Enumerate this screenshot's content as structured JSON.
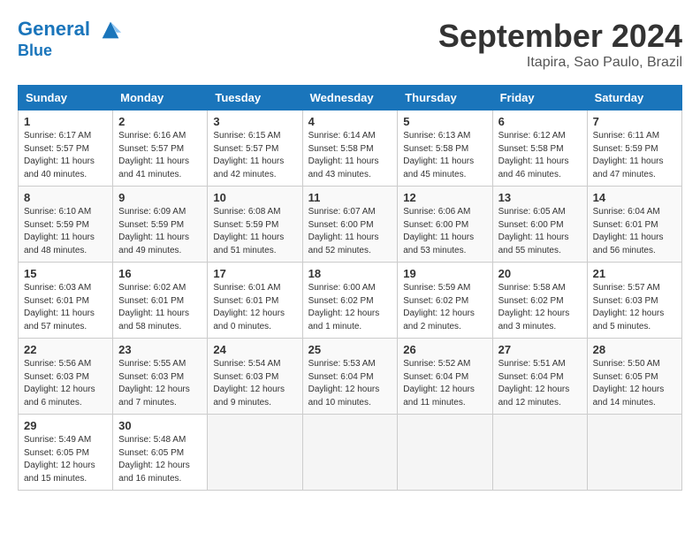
{
  "header": {
    "logo_line1": "General",
    "logo_line2": "Blue",
    "month": "September 2024",
    "location": "Itapira, Sao Paulo, Brazil"
  },
  "days_of_week": [
    "Sunday",
    "Monday",
    "Tuesday",
    "Wednesday",
    "Thursday",
    "Friday",
    "Saturday"
  ],
  "weeks": [
    [
      {
        "day": "1",
        "sunrise": "6:17 AM",
        "sunset": "5:57 PM",
        "daylight": "11 hours and 40 minutes."
      },
      {
        "day": "2",
        "sunrise": "6:16 AM",
        "sunset": "5:57 PM",
        "daylight": "11 hours and 41 minutes."
      },
      {
        "day": "3",
        "sunrise": "6:15 AM",
        "sunset": "5:57 PM",
        "daylight": "11 hours and 42 minutes."
      },
      {
        "day": "4",
        "sunrise": "6:14 AM",
        "sunset": "5:58 PM",
        "daylight": "11 hours and 43 minutes."
      },
      {
        "day": "5",
        "sunrise": "6:13 AM",
        "sunset": "5:58 PM",
        "daylight": "11 hours and 45 minutes."
      },
      {
        "day": "6",
        "sunrise": "6:12 AM",
        "sunset": "5:58 PM",
        "daylight": "11 hours and 46 minutes."
      },
      {
        "day": "7",
        "sunrise": "6:11 AM",
        "sunset": "5:59 PM",
        "daylight": "11 hours and 47 minutes."
      }
    ],
    [
      {
        "day": "8",
        "sunrise": "6:10 AM",
        "sunset": "5:59 PM",
        "daylight": "11 hours and 48 minutes."
      },
      {
        "day": "9",
        "sunrise": "6:09 AM",
        "sunset": "5:59 PM",
        "daylight": "11 hours and 49 minutes."
      },
      {
        "day": "10",
        "sunrise": "6:08 AM",
        "sunset": "5:59 PM",
        "daylight": "11 hours and 51 minutes."
      },
      {
        "day": "11",
        "sunrise": "6:07 AM",
        "sunset": "6:00 PM",
        "daylight": "11 hours and 52 minutes."
      },
      {
        "day": "12",
        "sunrise": "6:06 AM",
        "sunset": "6:00 PM",
        "daylight": "11 hours and 53 minutes."
      },
      {
        "day": "13",
        "sunrise": "6:05 AM",
        "sunset": "6:00 PM",
        "daylight": "11 hours and 55 minutes."
      },
      {
        "day": "14",
        "sunrise": "6:04 AM",
        "sunset": "6:01 PM",
        "daylight": "11 hours and 56 minutes."
      }
    ],
    [
      {
        "day": "15",
        "sunrise": "6:03 AM",
        "sunset": "6:01 PM",
        "daylight": "11 hours and 57 minutes."
      },
      {
        "day": "16",
        "sunrise": "6:02 AM",
        "sunset": "6:01 PM",
        "daylight": "11 hours and 58 minutes."
      },
      {
        "day": "17",
        "sunrise": "6:01 AM",
        "sunset": "6:01 PM",
        "daylight": "12 hours and 0 minutes."
      },
      {
        "day": "18",
        "sunrise": "6:00 AM",
        "sunset": "6:02 PM",
        "daylight": "12 hours and 1 minute."
      },
      {
        "day": "19",
        "sunrise": "5:59 AM",
        "sunset": "6:02 PM",
        "daylight": "12 hours and 2 minutes."
      },
      {
        "day": "20",
        "sunrise": "5:58 AM",
        "sunset": "6:02 PM",
        "daylight": "12 hours and 3 minutes."
      },
      {
        "day": "21",
        "sunrise": "5:57 AM",
        "sunset": "6:03 PM",
        "daylight": "12 hours and 5 minutes."
      }
    ],
    [
      {
        "day": "22",
        "sunrise": "5:56 AM",
        "sunset": "6:03 PM",
        "daylight": "12 hours and 6 minutes."
      },
      {
        "day": "23",
        "sunrise": "5:55 AM",
        "sunset": "6:03 PM",
        "daylight": "12 hours and 7 minutes."
      },
      {
        "day": "24",
        "sunrise": "5:54 AM",
        "sunset": "6:03 PM",
        "daylight": "12 hours and 9 minutes."
      },
      {
        "day": "25",
        "sunrise": "5:53 AM",
        "sunset": "6:04 PM",
        "daylight": "12 hours and 10 minutes."
      },
      {
        "day": "26",
        "sunrise": "5:52 AM",
        "sunset": "6:04 PM",
        "daylight": "12 hours and 11 minutes."
      },
      {
        "day": "27",
        "sunrise": "5:51 AM",
        "sunset": "6:04 PM",
        "daylight": "12 hours and 12 minutes."
      },
      {
        "day": "28",
        "sunrise": "5:50 AM",
        "sunset": "6:05 PM",
        "daylight": "12 hours and 14 minutes."
      }
    ],
    [
      {
        "day": "29",
        "sunrise": "5:49 AM",
        "sunset": "6:05 PM",
        "daylight": "12 hours and 15 minutes."
      },
      {
        "day": "30",
        "sunrise": "5:48 AM",
        "sunset": "6:05 PM",
        "daylight": "12 hours and 16 minutes."
      },
      null,
      null,
      null,
      null,
      null
    ]
  ],
  "labels": {
    "sunrise": "Sunrise:",
    "sunset": "Sunset:",
    "daylight": "Daylight:"
  }
}
